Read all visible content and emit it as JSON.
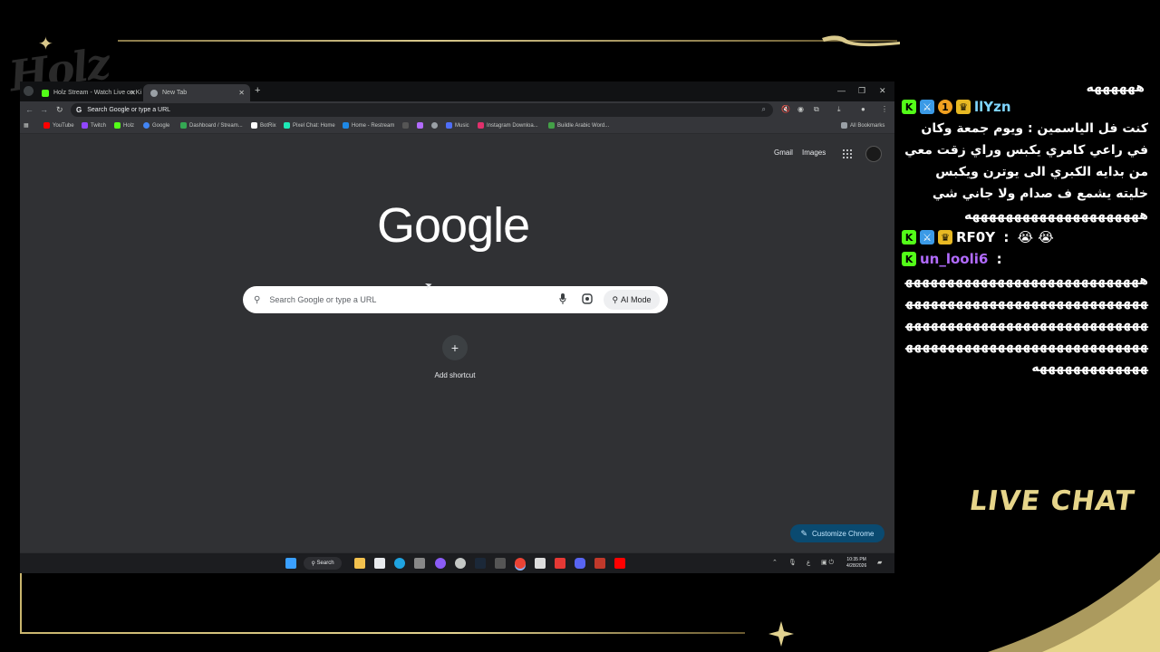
{
  "overlay": {
    "logo_text": "Holz",
    "live_chat_label": "LIVE CHAT"
  },
  "browser": {
    "tabs": [
      {
        "title": "Holz Stream - Watch Live on Ki",
        "favicon_color": "#53fc18"
      },
      {
        "title": "New Tab",
        "favicon_color": "#9aa0a6"
      }
    ],
    "omnibox_text": "Search Google or type a URL",
    "bookmarks": [
      {
        "label": "YouTube",
        "color": "#ff0000"
      },
      {
        "label": "Twitch",
        "color": "#9146ff"
      },
      {
        "label": "Holz",
        "color": "#53fc18"
      },
      {
        "label": "Google",
        "color": "#4285f4"
      },
      {
        "label": "Dashboard / Stream...",
        "color": "#34a853"
      },
      {
        "label": "BotRix",
        "color": "#ffffff"
      },
      {
        "label": "Pixel Chat: Home",
        "color": "#1de9b6"
      },
      {
        "label": "Home - Restream",
        "color": "#1e88e5"
      },
      {
        "label": "Music",
        "color": "#4f6ef7"
      },
      {
        "label": "Instagram Downloa...",
        "color": "#e1306c"
      },
      {
        "label": "Buildle Arabic Word...",
        "color": "#43a047"
      }
    ],
    "all_bookmarks_label": "All Bookmarks"
  },
  "newtab": {
    "gmail_link": "Gmail",
    "images_link": "Images",
    "logo": "Google",
    "search_placeholder": "Search Google or type a URL",
    "ai_mode_label": "AI Mode",
    "add_shortcut_label": "Add shortcut",
    "customize_label": "Customize Chrome"
  },
  "taskbar": {
    "search_label": "Search",
    "time": "10:35 PM",
    "date": "4/28/2026",
    "lang": "ع"
  },
  "chat": {
    "top_fragment": "ههههههه",
    "messages": [
      {
        "username": "llYzn",
        "username_color": "#7fd4ff",
        "badge_number": "1",
        "text": "كنت فل الياسمين : ويوم جمعة وكان في راعي كامري يكبس وراي زقت معي من بدايه الكبري الى يوترن ويكبس خليته يشمع ف صدام ولا جاني شي هههههههههههههههههههههه"
      },
      {
        "username": "RF0Y",
        "username_color": "#ffffff",
        "text": "😭 😭"
      },
      {
        "username": "un_looli6",
        "username_color": "#b26bff",
        "text": "هههههههههههههههههههههههههههههههههههههههههههههههههههههههههههههههههههههههههههههههههههههههههههههههههههههههههههههههههههههههههههههههههه"
      }
    ]
  }
}
